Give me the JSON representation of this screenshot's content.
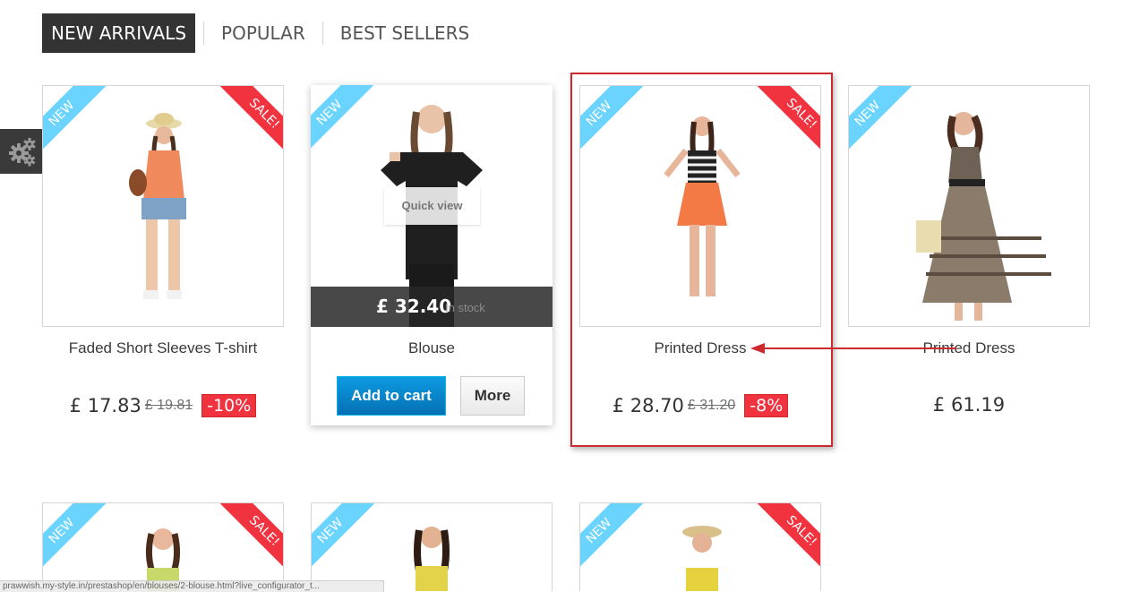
{
  "tabs": [
    {
      "label": "New Arrivals",
      "active": true
    },
    {
      "label": "Popular",
      "active": false
    },
    {
      "label": "Best Sellers",
      "active": false
    }
  ],
  "ribbons": {
    "new": "New",
    "sale": "Sale!"
  },
  "products": [
    {
      "name": "Faded Short Sleeves T-shirt",
      "price": "£ 17.83",
      "old_price": "£ 19.81",
      "discount": "-10%"
    },
    {
      "name": "Blouse",
      "price": "£ 32.40",
      "stock": "In stock",
      "quick_view": "Quick view",
      "add_to_cart": "Add to cart",
      "more": "More"
    },
    {
      "name": "Printed Dress",
      "price": "£ 28.70",
      "old_price": "£ 31.20",
      "discount": "-8%"
    },
    {
      "name": "Printed Dress",
      "price": "£ 61.19"
    }
  ],
  "status_url": "prawwish.my-style.in/prestashop/en/blouses/2-blouse.html?live_configurator_t...",
  "colors": {
    "new_ribbon": "#6ad4ff",
    "sale_ribbon": "#f13340",
    "highlight": "#cc2a2f",
    "cart_button": "#0670b6"
  },
  "icons": [
    "gears-icon",
    "arrow-left-icon"
  ]
}
